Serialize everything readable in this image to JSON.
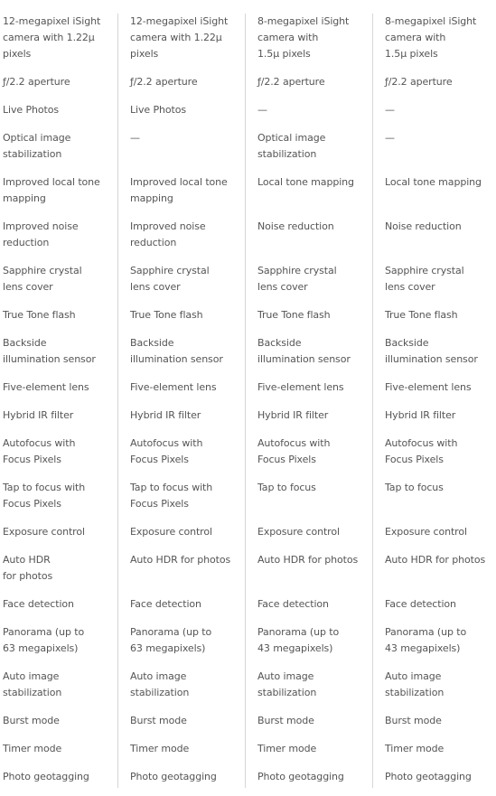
{
  "rows": [
    [
      "12-megapixel iSight\ncamera with 1.22μ\npixels",
      "12-megapixel iSight\ncamera with 1.22μ\npixels",
      "8-megapixel iSight\ncamera with\n1.5μ pixels",
      "8-megapixel iSight\ncamera with\n1.5μ pixels"
    ],
    [
      "ƒ/2.2 aperture",
      "ƒ/2.2 aperture",
      "ƒ/2.2 aperture",
      "ƒ/2.2 aperture"
    ],
    [
      "Live Photos",
      "Live Photos",
      "—",
      "—"
    ],
    [
      "Optical image\nstabilization",
      "—",
      "Optical image\nstabilization",
      "—"
    ],
    [
      "Improved local tone\nmapping",
      "Improved local tone\nmapping",
      "Local tone mapping",
      "Local tone mapping"
    ],
    [
      "Improved noise\nreduction",
      "Improved noise\nreduction",
      "Noise reduction",
      "Noise reduction"
    ],
    [
      "Sapphire crystal\nlens cover",
      "Sapphire crystal\nlens cover",
      "Sapphire crystal\nlens cover",
      "Sapphire crystal\nlens cover"
    ],
    [
      "True Tone flash",
      "True Tone flash",
      "True Tone flash",
      "True Tone flash"
    ],
    [
      "Backside\nillumination sensor",
      "Backside\nillumination sensor",
      "Backside\nillumination sensor",
      "Backside\nillumination sensor"
    ],
    [
      "Five-element lens",
      "Five-element lens",
      "Five-element lens",
      "Five-element lens"
    ],
    [
      "Hybrid IR filter",
      "Hybrid IR filter",
      "Hybrid IR filter",
      "Hybrid IR filter"
    ],
    [
      "Autofocus with\nFocus Pixels",
      "Autofocus with\nFocus Pixels",
      "Autofocus with\nFocus Pixels",
      "Autofocus with\nFocus Pixels"
    ],
    [
      "Tap to focus with\nFocus Pixels",
      "Tap to focus with\nFocus Pixels",
      "Tap to focus",
      "Tap to focus"
    ],
    [
      "Exposure control",
      "Exposure control",
      "Exposure control",
      "Exposure control"
    ],
    [
      "Auto HDR\nfor photos",
      "Auto HDR for photos",
      "Auto HDR for photos",
      "Auto HDR for photos"
    ],
    [
      "Face detection",
      "Face detection",
      "Face detection",
      "Face detection"
    ],
    [
      "Panorama (up to\n63 megapixels)",
      "Panorama (up to\n63 megapixels)",
      "Panorama (up to\n43 megapixels)",
      "Panorama (up to\n43 megapixels)"
    ],
    [
      "Auto image\nstabilization",
      "Auto image\nstabilization",
      "Auto image\nstabilization",
      "Auto image\nstabilization"
    ],
    [
      "Burst mode",
      "Burst mode",
      "Burst mode",
      "Burst mode"
    ],
    [
      "Timer mode",
      "Timer mode",
      "Timer mode",
      "Timer mode"
    ],
    [
      "Photo geotagging",
      "Photo geotagging",
      "Photo geotagging",
      "Photo geotagging"
    ]
  ]
}
